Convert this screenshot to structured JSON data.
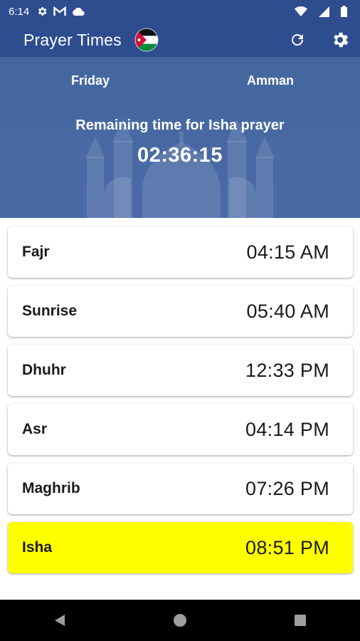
{
  "status_bar": {
    "time": "6:14",
    "icons": [
      "gear-icon",
      "gmail-icon",
      "cloud-icon"
    ],
    "right_icons": [
      "wifi-icon",
      "signal-icon",
      "battery-icon"
    ]
  },
  "app_bar": {
    "title": "Prayer Times",
    "flag": "jordan-flag-icon",
    "actions": [
      "refresh-icon",
      "settings-icon"
    ]
  },
  "header": {
    "day": "Friday",
    "city": "Amman",
    "remaining_label": "Remaining time for Isha prayer",
    "countdown": "02:36:15"
  },
  "prayers": [
    {
      "name": "Fajr",
      "time": "04:15 AM"
    },
    {
      "name": "Sunrise",
      "time": "05:40 AM"
    },
    {
      "name": "Dhuhr",
      "time": "12:33 PM"
    },
    {
      "name": "Asr",
      "time": "04:14 PM"
    },
    {
      "name": "Maghrib",
      "time": "07:26 PM"
    },
    {
      "name": "Isha",
      "time": "08:51 PM",
      "highlighted": true
    }
  ],
  "colors": {
    "primary": "#2e4d8f",
    "header_bg": "#4a6aa6",
    "highlight": "#ffff00",
    "text": "#1a1a1a"
  },
  "nav_bar": [
    "back-icon",
    "home-icon",
    "recents-icon"
  ]
}
